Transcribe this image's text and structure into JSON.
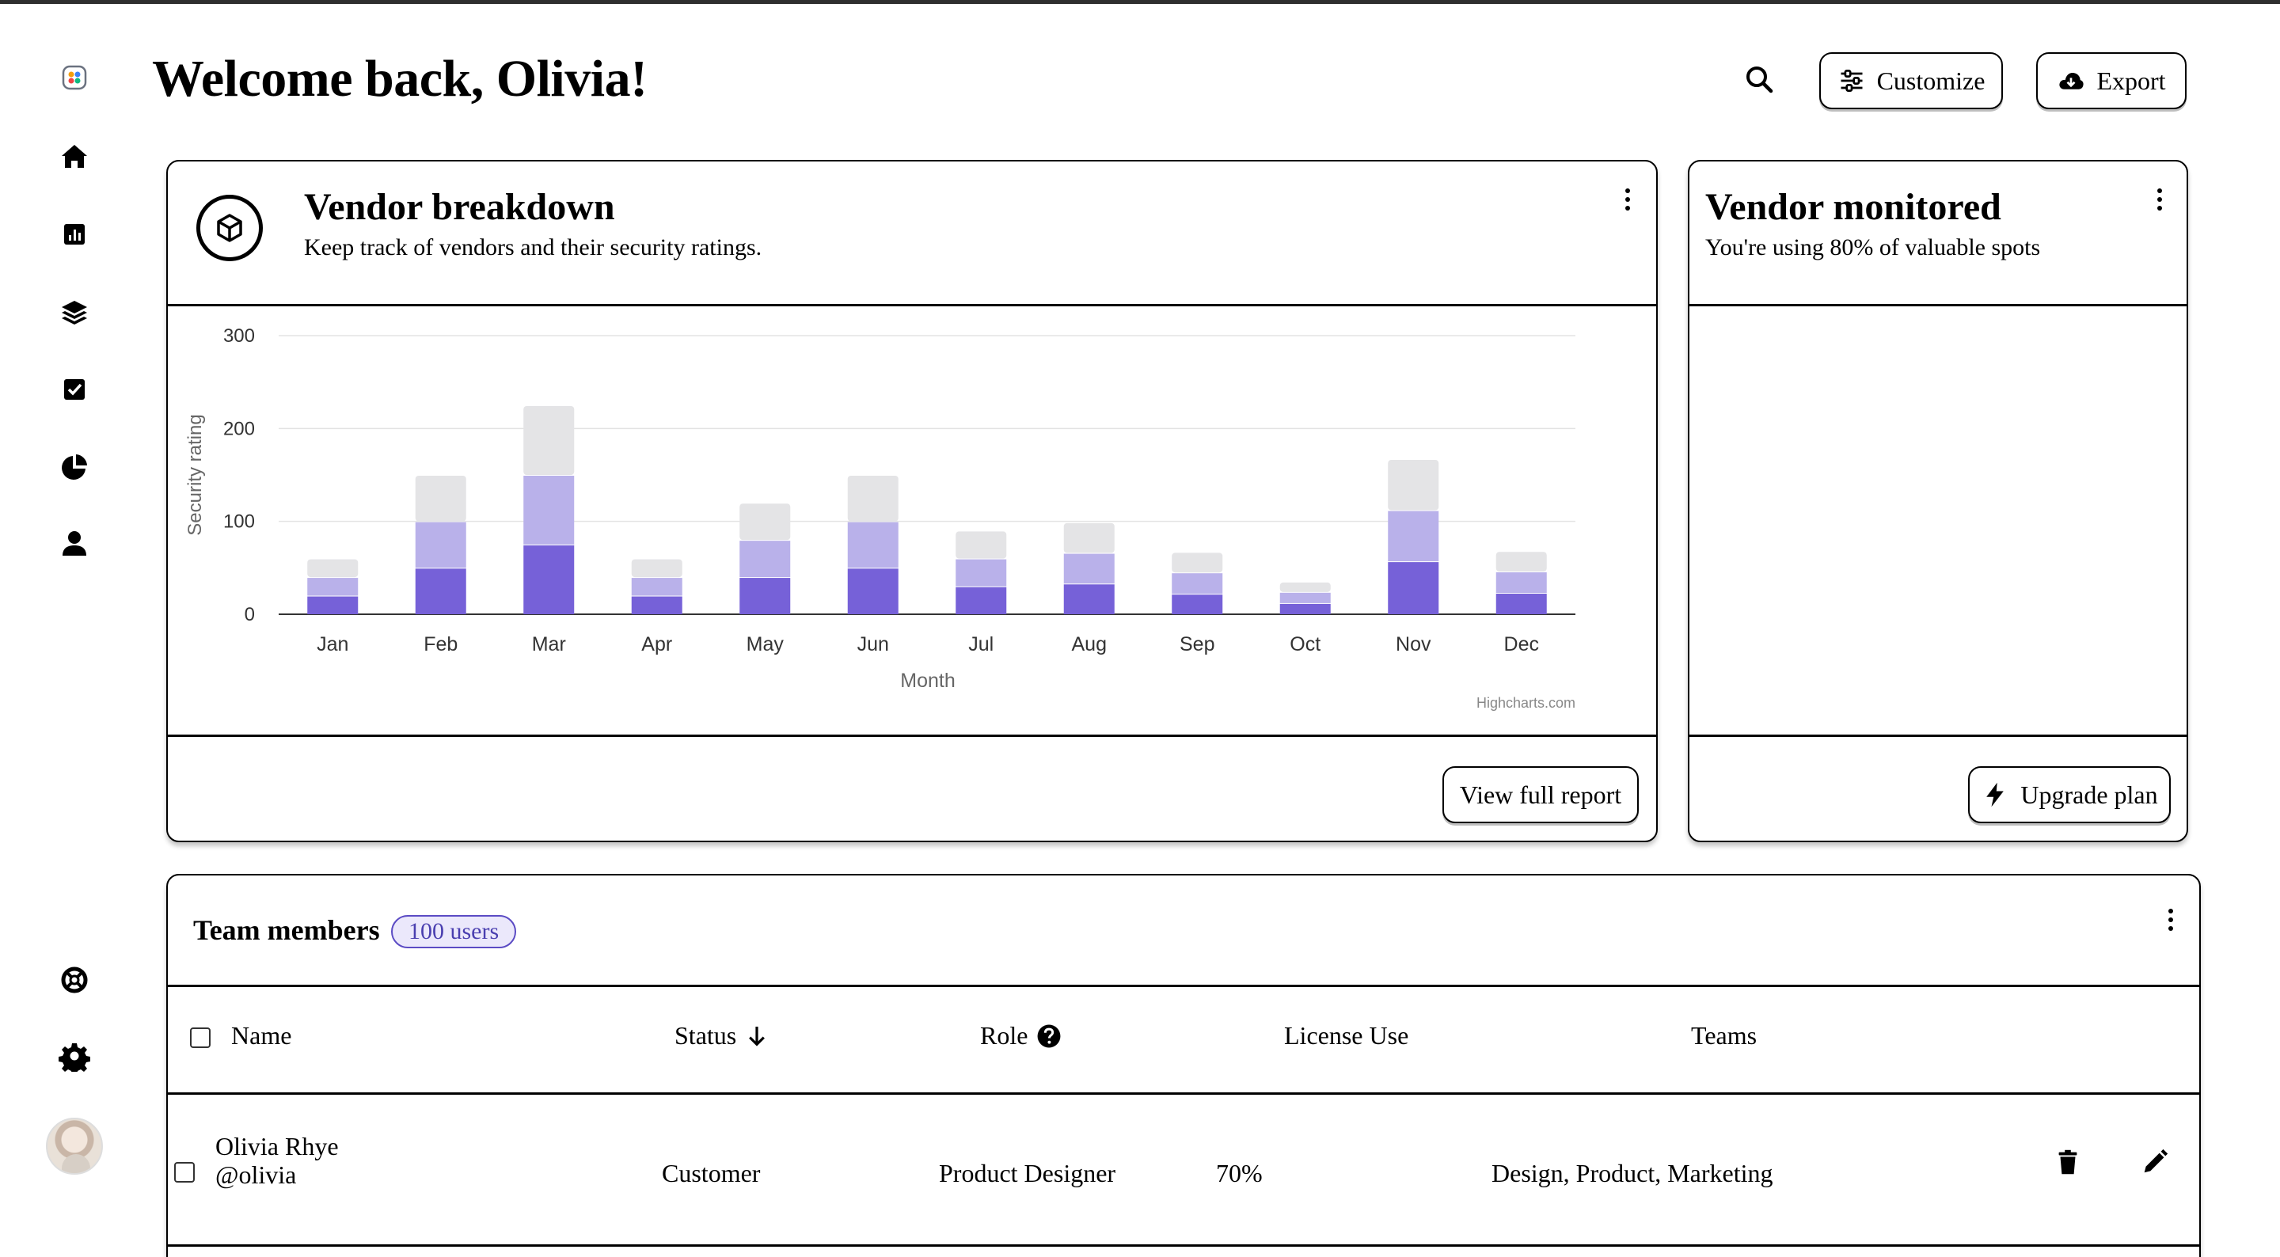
{
  "header": {
    "title": "Welcome back, Olivia!",
    "customize_label": "Customize",
    "export_label": "Export"
  },
  "sidebar": {
    "items": [
      {
        "icon": "logo-icon"
      },
      {
        "icon": "home-icon"
      },
      {
        "icon": "bar-chart-icon"
      },
      {
        "icon": "layers-icon"
      },
      {
        "icon": "check-square-icon"
      },
      {
        "icon": "pie-chart-icon"
      },
      {
        "icon": "user-icon"
      }
    ],
    "bottom": [
      {
        "icon": "support-icon"
      },
      {
        "icon": "gear-icon"
      },
      {
        "icon": "avatar"
      }
    ]
  },
  "vendor_breakdown": {
    "title": "Vendor breakdown",
    "subtitle": "Keep track of vendors and their security ratings.",
    "button_label": "View full report",
    "credit": "Highcharts.com"
  },
  "vendor_monitored": {
    "title": "Vendor monitored",
    "subtitle": "You're using 80% of valuable spots",
    "button_label": "Upgrade plan"
  },
  "team": {
    "title": "Team members",
    "badge": "100 users",
    "columns": {
      "name": "Name",
      "status": "Status",
      "role": "Role",
      "license": "License Use",
      "teams": "Teams"
    },
    "rows": [
      {
        "name": "Olivia Rhye",
        "handle": "@olivia",
        "status": "Customer",
        "role": "Product Designer",
        "license": "70%",
        "teams": "Design, Product, Marketing"
      }
    ]
  },
  "colors": {
    "series_dark": "#7661d8",
    "series_mid": "#b9b1ea",
    "series_light": "#e4e4e6",
    "badge_border": "#5b4bc4"
  },
  "chart_data": {
    "type": "bar",
    "stacked": true,
    "categories": [
      "Jan",
      "Feb",
      "Mar",
      "Apr",
      "May",
      "Jun",
      "Jul",
      "Aug",
      "Sep",
      "Oct",
      "Nov",
      "Dec"
    ],
    "series": [
      {
        "values": [
          20,
          50,
          75,
          20,
          40,
          50,
          30,
          33,
          22,
          12,
          57,
          23
        ]
      },
      {
        "values": [
          20,
          50,
          75,
          20,
          40,
          50,
          30,
          33,
          23,
          12,
          55,
          23
        ]
      },
      {
        "values": [
          20,
          50,
          75,
          20,
          40,
          50,
          30,
          33,
          22,
          11,
          55,
          22
        ]
      }
    ],
    "xlabel": "Month",
    "ylabel": "Security rating",
    "ylim": [
      0,
      300
    ],
    "yticks": [
      0,
      100,
      200,
      300
    ],
    "grid": true,
    "legend": "none"
  }
}
